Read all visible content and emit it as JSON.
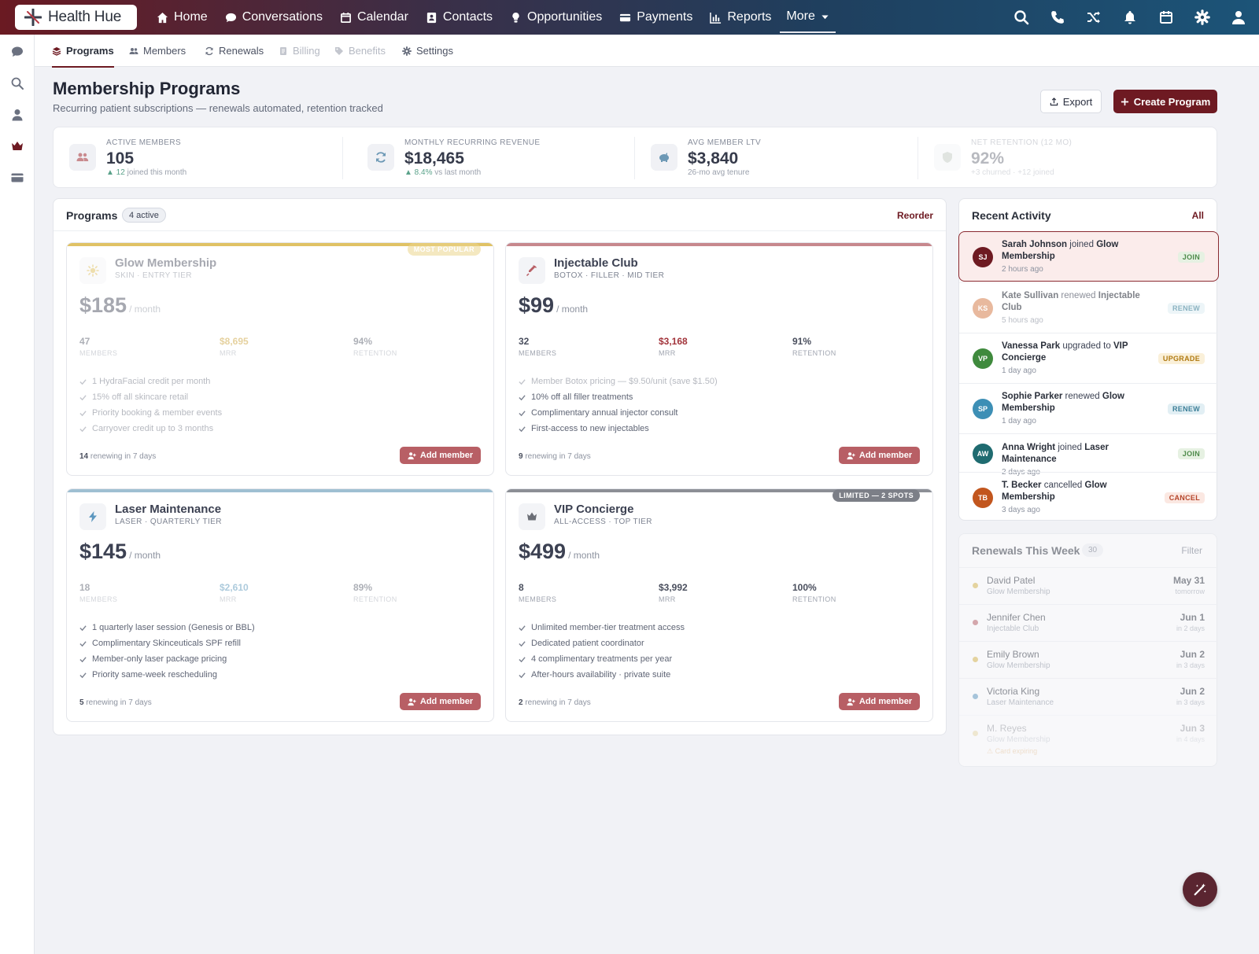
{
  "brand": {
    "name": "Health Hue"
  },
  "nav": {
    "items": [
      {
        "label": "Home",
        "icon": "home-icon"
      },
      {
        "label": "Conversations",
        "icon": "chat-icon"
      },
      {
        "label": "Calendar",
        "icon": "calendar-icon"
      },
      {
        "label": "Contacts",
        "icon": "contacts-icon"
      },
      {
        "label": "Opportunities",
        "icon": "lightbulb-icon"
      },
      {
        "label": "Payments",
        "icon": "credit-card-icon"
      },
      {
        "label": "Reports",
        "icon": "bar-chart-icon"
      }
    ],
    "more": "More"
  },
  "subnav": {
    "tabs": [
      {
        "label": "Programs",
        "icon": "layers-icon",
        "state": "active"
      },
      {
        "label": "Members",
        "icon": "users-icon",
        "state": "normal"
      },
      {
        "label": "Renewals",
        "icon": "refresh-icon",
        "state": "normal"
      },
      {
        "label": "Billing",
        "icon": "document-icon",
        "state": "disabled"
      },
      {
        "label": "Benefits",
        "icon": "tag-icon",
        "state": "disabled"
      },
      {
        "label": "Settings",
        "icon": "gear-icon",
        "state": "normal"
      }
    ]
  },
  "header": {
    "title": "Membership Programs",
    "subtitle": "Recurring patient subscriptions — renewals automated, retention tracked",
    "export_label": "Export",
    "create_label": "Create Program"
  },
  "stats": [
    {
      "label": "ACTIVE MEMBERS",
      "value": "105",
      "note_strong": "▲ 12",
      "note": "joined this month",
      "icon": "users-icon"
    },
    {
      "label": "MONTHLY RECURRING REVENUE",
      "value": "$18,465",
      "note_strong": "▲ 8.4%",
      "note": "vs last month",
      "icon": "refresh-icon"
    },
    {
      "label": "AVG MEMBER LTV",
      "value": "$3,840",
      "note_strong": "",
      "note": "26-mo avg tenure",
      "icon": "piggy-bank-icon"
    },
    {
      "label": "NET RETENTION (12 MO)",
      "value": "92%",
      "note_strong": "",
      "note": "+3 churned · +12 joined",
      "icon": "shield-icon"
    }
  ],
  "programs": {
    "title": "Programs",
    "badge": "4 active",
    "reorder": "Reorder",
    "items": [
      {
        "name": "Glow Membership",
        "tier": "SKIN · ENTRY TIER",
        "price": "$185",
        "per": "/ month",
        "tag": "MOST POPULAR",
        "accent": "#d9b54a",
        "icon": "sun-icon",
        "metrics": [
          {
            "value": "47",
            "label": "MEMBERS"
          },
          {
            "value": "$8,695",
            "label": "MRR"
          },
          {
            "value": "94%",
            "label": "RETENTION"
          }
        ],
        "benefits": [
          "1 HydraFacial credit per month",
          "15% off all skincare retail",
          "Priority booking & member events",
          "Carryover credit up to 3 months"
        ],
        "renewing_count": "14",
        "renewing_text": "renewing in 7 days",
        "add_label": "Add member"
      },
      {
        "name": "Injectable Club",
        "tier": "BOTOX · FILLER · MID TIER",
        "price": "$99",
        "per": "/ month",
        "tag": "",
        "accent": "#c7888d",
        "icon": "syringe-icon",
        "metrics": [
          {
            "value": "32",
            "label": "MEMBERS"
          },
          {
            "value": "$3,168",
            "label": "MRR"
          },
          {
            "value": "91%",
            "label": "RETENTION"
          }
        ],
        "benefits": [
          "Member Botox pricing — $9.50/unit (save $1.50)",
          "10% off all filler treatments",
          "Complimentary annual injector consult",
          "First-access to new injectables"
        ],
        "renewing_count": "9",
        "renewing_text": "renewing in 7 days",
        "add_label": "Add member"
      },
      {
        "name": "Laser Maintenance",
        "tier": "LASER · QUARTERLY TIER",
        "price": "$145",
        "per": "/ month",
        "tag": "",
        "accent": "#8fb1c5",
        "icon": "bolt-icon",
        "metrics": [
          {
            "value": "18",
            "label": "MEMBERS"
          },
          {
            "value": "$2,610",
            "label": "MRR"
          },
          {
            "value": "89%",
            "label": "RETENTION"
          }
        ],
        "benefits": [
          "1 quarterly laser session (Genesis or BBL)",
          "Complimentary Skinceuticals SPF refill",
          "Member-only laser package pricing",
          "Priority same-week rescheduling"
        ],
        "renewing_count": "5",
        "renewing_text": "renewing in 7 days",
        "add_label": "Add member"
      },
      {
        "name": "VIP Concierge",
        "tier": "ALL-ACCESS · TOP TIER",
        "price": "$499",
        "per": "/ month",
        "tag": "LIMITED — 2 SPOTS",
        "accent": "#8c8f96",
        "icon": "crown-icon",
        "metrics": [
          {
            "value": "8",
            "label": "MEMBERS"
          },
          {
            "value": "$3,992",
            "label": "MRR"
          },
          {
            "value": "100%",
            "label": "RETENTION"
          }
        ],
        "benefits": [
          "Unlimited member-tier treatment access",
          "Dedicated patient coordinator",
          "4 complimentary treatments per year",
          "After-hours availability · private suite"
        ],
        "renewing_count": "2",
        "renewing_text": "renewing in 7 days",
        "add_label": "Add member"
      }
    ]
  },
  "activity": {
    "title": "Recent Activity",
    "all": "All",
    "items": [
      {
        "initials": "SJ",
        "color": "#6e1a22",
        "name": "Sarah Johnson",
        "verb": "joined",
        "target": "Glow Membership",
        "time": "2 hours ago",
        "badge": "JOIN",
        "badge_fg": "#4d8a4a",
        "badge_bg": "#e6f1e2"
      },
      {
        "initials": "KS",
        "color": "#d98c5f",
        "name": "Kate Sullivan",
        "verb": "renewed",
        "target": "Injectable Club",
        "time": "5 hours ago",
        "badge": "RENEW",
        "badge_fg": "#3d7f98",
        "badge_bg": "#e2eff4"
      },
      {
        "initials": "VP",
        "color": "#3f8a3d",
        "name": "Vanessa Park",
        "verb": "upgraded to",
        "target": "VIP Concierge",
        "time": "1 day ago",
        "badge": "UPGRADE",
        "badge_fg": "#b07a12",
        "badge_bg": "#faf0d9"
      },
      {
        "initials": "SP",
        "color": "#3d8fb5",
        "name": "Sophie Parker",
        "verb": "renewed",
        "target": "Glow Membership",
        "time": "1 day ago",
        "badge": "RENEW",
        "badge_fg": "#3d7f98",
        "badge_bg": "#e2eff4"
      },
      {
        "initials": "AW",
        "color": "#1f6b70",
        "name": "Anna Wright",
        "verb": "joined",
        "target": "Laser Maintenance",
        "time": "2 days ago",
        "badge": "JOIN",
        "badge_fg": "#4d8a4a",
        "badge_bg": "#e6f1e2"
      },
      {
        "initials": "TB",
        "color": "#c2561e",
        "name": "T. Becker",
        "verb": "cancelled",
        "target": "Glow Membership",
        "time": "3 days ago",
        "badge": "CANCEL",
        "badge_fg": "#b5452a",
        "badge_bg": "#fbe8e2"
      }
    ]
  },
  "renewals": {
    "title": "Renewals This Week",
    "count": "30",
    "filter": "Filter",
    "items": [
      {
        "name": "David Patel",
        "program": "Glow Membership",
        "date": "May 31",
        "rel": "tomorrow",
        "dot": "#d9b54a",
        "warning": ""
      },
      {
        "name": "Jennifer Chen",
        "program": "Injectable Club",
        "date": "Jun 1",
        "rel": "in 2 days",
        "dot": "#b85f65",
        "warning": ""
      },
      {
        "name": "Emily Brown",
        "program": "Glow Membership",
        "date": "Jun 2",
        "rel": "in 3 days",
        "dot": "#d9b54a",
        "warning": ""
      },
      {
        "name": "Victoria King",
        "program": "Laser Maintenance",
        "date": "Jun 2",
        "rel": "in 3 days",
        "dot": "#5d97bf",
        "warning": ""
      },
      {
        "name": "M. Reyes",
        "program": "Glow Membership",
        "date": "Jun 3",
        "rel": "in 4 days",
        "dot": "#d9b54a",
        "warning": "⚠ Card expiring"
      }
    ]
  }
}
